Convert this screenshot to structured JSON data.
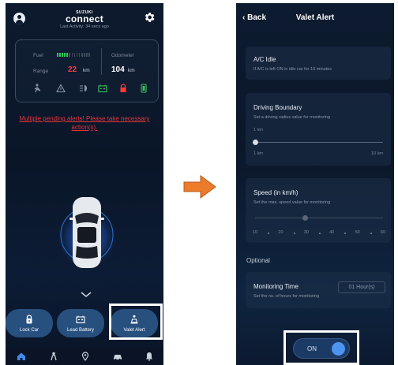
{
  "left": {
    "brand_top": "SUZUKI",
    "brand": "connect",
    "last_activity": "Last Activity: 34 secs ago",
    "fuel_label": "Fuel",
    "fuel_level_fraction": 0.35,
    "range_label": "Range",
    "range_value": "22",
    "range_unit": "km",
    "odometer_label": "Odometer",
    "odometer_value": "104",
    "odometer_unit": "km",
    "status_icons": [
      "seatbelt-icon",
      "warning-triangle-icon",
      "headlight-icon",
      "battery-icon",
      "door-lock-icon",
      "fuel-pump-icon"
    ],
    "alert_message": "Multiple pending alerts! Please take necessary action(s).",
    "features": [
      {
        "label": "Lock Car",
        "icon": "lock-icon"
      },
      {
        "label": "Lead Battery",
        "icon": "battery-icon"
      },
      {
        "label": "Valet Alert",
        "icon": "valet-icon"
      }
    ],
    "nav": [
      "home-icon",
      "person-nav-icon",
      "location-pin-icon",
      "car-service-icon",
      "bell-icon"
    ]
  },
  "right": {
    "back_label": "Back",
    "title": "Valet Alert",
    "ac_idle_title": "A/C Idle",
    "ac_idle_desc": "If A/C is left ON in idle car for 10 minutes",
    "boundary_title": "Driving Boundary",
    "boundary_desc": "Set a driving radius value for monitoring",
    "boundary_current": "1 km",
    "boundary_min": "1 km",
    "boundary_max": "10 km",
    "speed_title": "Speed (in km/h)",
    "speed_desc": "Set the max. speed value for monitoring",
    "speed_ticks": [
      "10",
      "20",
      "30",
      "40",
      "50",
      "60"
    ],
    "optional_label": "Optional",
    "monitoring_title": "Monitoring Time",
    "monitoring_desc": "Set the no. of hours for monitoring",
    "monitoring_value": "01 Hour(s)",
    "toggle_label": "ON"
  },
  "colors": {
    "alert": "#e8343c",
    "range_value": "#ff3b3b",
    "fuel_bar": "#35c45a",
    "feature_button": "#27507e",
    "toggle_knob": "#4d93f0",
    "arrow": "#ec7b2b"
  }
}
